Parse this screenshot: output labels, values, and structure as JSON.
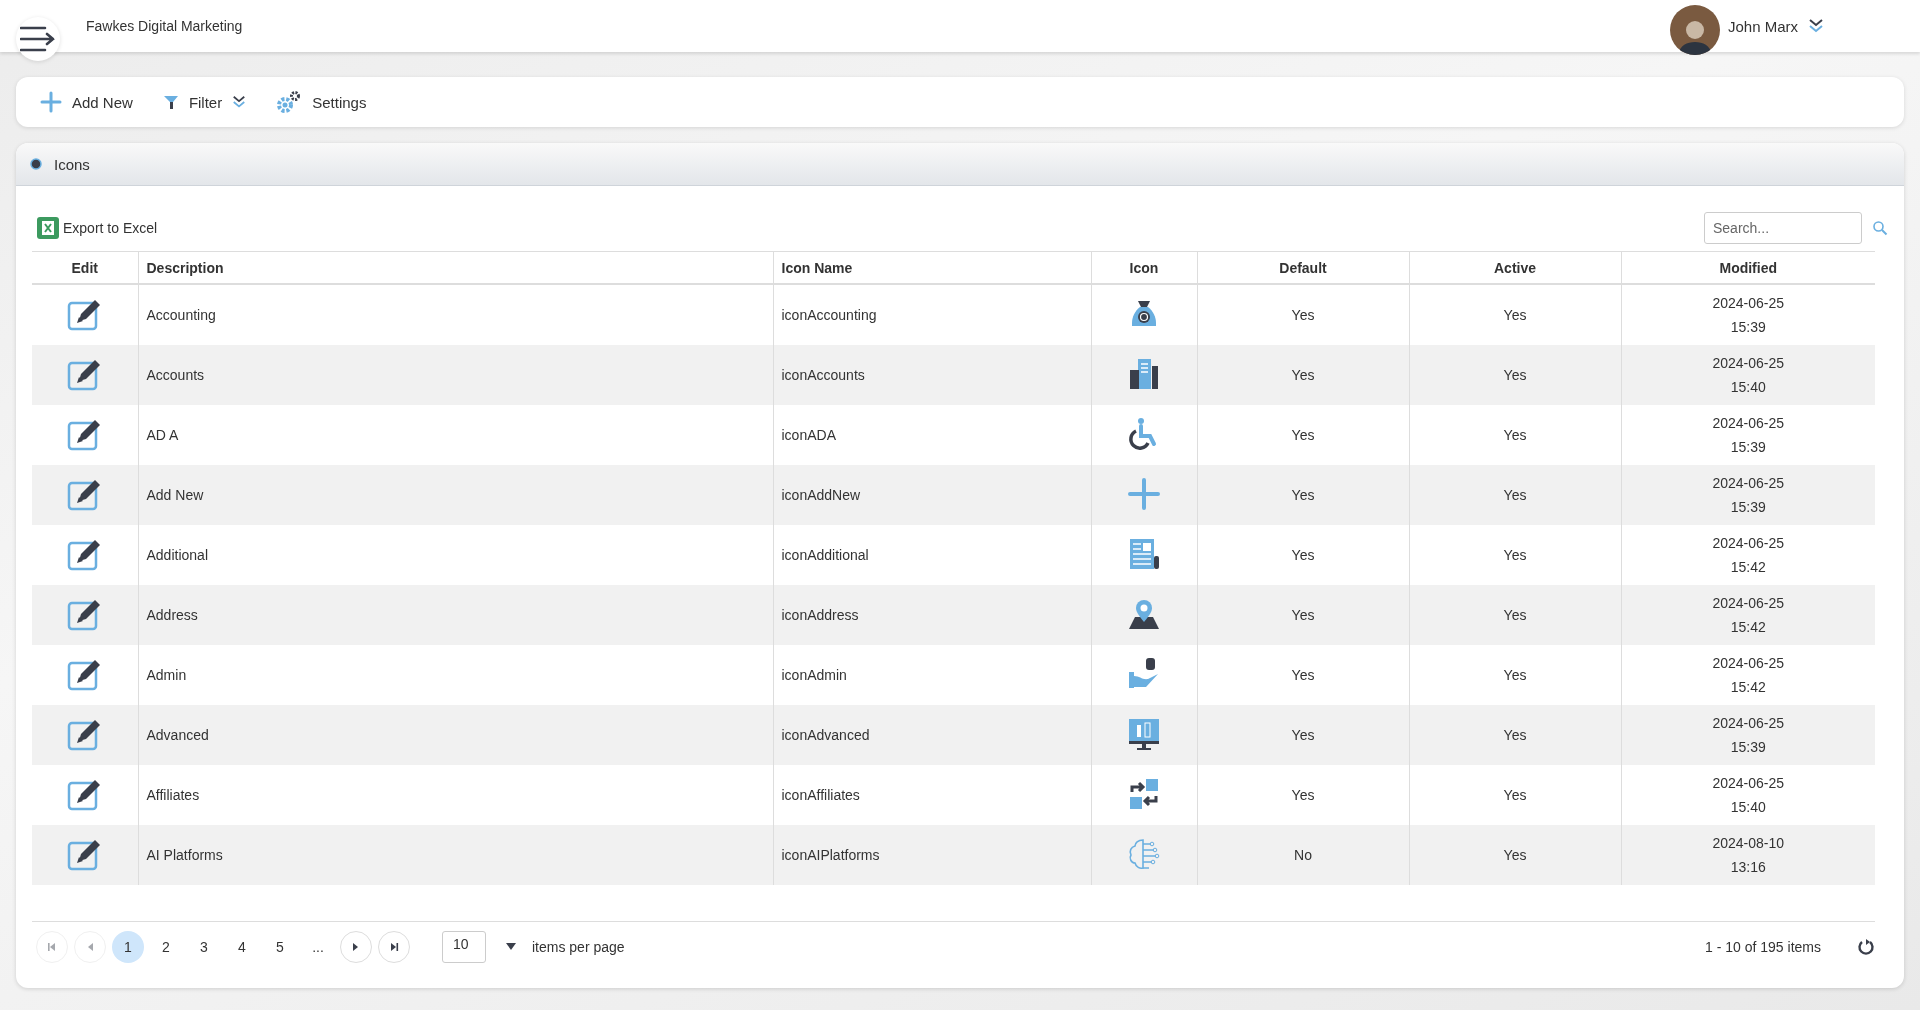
{
  "header": {
    "company": "Fawkes Digital Marketing",
    "user": "John Marx"
  },
  "toolbar": [
    {
      "kind": "add",
      "label": "Add New"
    },
    {
      "kind": "filter",
      "label": "Filter"
    },
    {
      "kind": "settings",
      "label": "Settings"
    }
  ],
  "panel": {
    "title": "Icons",
    "export": "Export to Excel",
    "search": {
      "placeholder": "Search..."
    }
  },
  "table": {
    "columns": [
      "Edit",
      "Description",
      "Icon Name",
      "Icon",
      "Default",
      "Active",
      "Modified"
    ],
    "rows": [
      {
        "description": "Accounting",
        "icon_name": "iconAccounting",
        "kind": "money-bag",
        "default": "Yes",
        "active": "Yes",
        "date": "2024-06-25",
        "time": "15:39"
      },
      {
        "description": "Accounts",
        "icon_name": "iconAccounts",
        "kind": "buildings",
        "default": "Yes",
        "active": "Yes",
        "date": "2024-06-25",
        "time": "15:40"
      },
      {
        "description": "AD A",
        "icon_name": "iconADA",
        "kind": "wheelchair",
        "default": "Yes",
        "active": "Yes",
        "date": "2024-06-25",
        "time": "15:39"
      },
      {
        "description": "Add New",
        "icon_name": "iconAddNew",
        "kind": "plus",
        "default": "Yes",
        "active": "Yes",
        "date": "2024-06-25",
        "time": "15:39"
      },
      {
        "description": "Additional",
        "icon_name": "iconAdditional",
        "kind": "newspaper",
        "default": "Yes",
        "active": "Yes",
        "date": "2024-06-25",
        "time": "15:42"
      },
      {
        "description": "Address",
        "icon_name": "iconAddress",
        "kind": "map-pin",
        "default": "Yes",
        "active": "Yes",
        "date": "2024-06-25",
        "time": "15:42"
      },
      {
        "description": "Admin",
        "icon_name": "iconAdmin",
        "kind": "hand-coins",
        "default": "Yes",
        "active": "Yes",
        "date": "2024-06-25",
        "time": "15:42"
      },
      {
        "description": "Advanced",
        "icon_name": "iconAdvanced",
        "kind": "monitor",
        "default": "Yes",
        "active": "Yes",
        "date": "2024-06-25",
        "time": "15:39"
      },
      {
        "description": "Affiliates",
        "icon_name": "iconAffiliates",
        "kind": "exchange",
        "default": "Yes",
        "active": "Yes",
        "date": "2024-06-25",
        "time": "15:40"
      },
      {
        "description": "AI Platforms",
        "icon_name": "iconAIPlatforms",
        "kind": "brain",
        "default": "No",
        "active": "Yes",
        "date": "2024-08-10",
        "time": "13:16"
      }
    ]
  },
  "pager": {
    "pages": [
      {
        "label": "1",
        "selected": true
      },
      {
        "label": "2",
        "selected": false
      },
      {
        "label": "3",
        "selected": false
      },
      {
        "label": "4",
        "selected": false
      },
      {
        "label": "5",
        "selected": false
      },
      {
        "label": "...",
        "selected": false
      }
    ],
    "page_size": "10",
    "page_size_label": "items per page",
    "summary": "1 - 10 of 195 items"
  }
}
